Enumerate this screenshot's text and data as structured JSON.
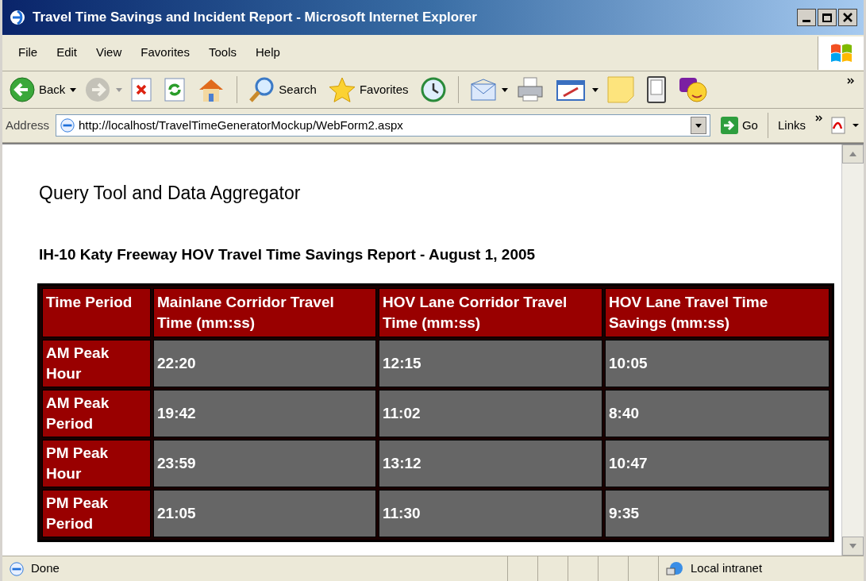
{
  "window": {
    "title": "Travel Time Savings and Incident Report - Microsoft Internet Explorer"
  },
  "menu": [
    "File",
    "Edit",
    "View",
    "Favorites",
    "Tools",
    "Help"
  ],
  "toolbar": [
    {
      "kind": "back",
      "label": "Back",
      "disabled": false
    },
    {
      "kind": "forward",
      "disabled": true
    },
    {
      "kind": "stop",
      "disabled": false
    },
    {
      "kind": "refresh",
      "disabled": false
    },
    {
      "kind": "home",
      "disabled": false
    },
    {
      "kind": "search",
      "label": "Search",
      "disabled": false
    },
    {
      "kind": "favorites",
      "label": "Favorites",
      "disabled": false
    },
    {
      "kind": "history",
      "disabled": false
    },
    {
      "kind": "mail",
      "disabled": false
    },
    {
      "kind": "print",
      "disabled": false
    },
    {
      "kind": "edit",
      "disabled": false
    },
    {
      "kind": "note",
      "disabled": false
    },
    {
      "kind": "device",
      "disabled": false
    },
    {
      "kind": "messenger",
      "disabled": false
    }
  ],
  "address_bar": {
    "label": "Address",
    "value": "http://localhost/TravelTimeGeneratorMockup/WebForm2.aspx",
    "go": "Go",
    "links": "Links"
  },
  "page": {
    "heading": "Query Tool and Data Aggregator",
    "report_title": "IH-10 Katy Freeway HOV Travel Time Savings Report - August 1, 2005",
    "table": {
      "columns": [
        "Time Period",
        "Mainlane Corridor Travel Time (mm:ss)",
        "HOV Lane Corridor Travel Time (mm:ss)",
        "HOV Lane Travel Time Savings (mm:ss)"
      ],
      "rows": [
        [
          "AM Peak Hour",
          "22:20",
          "12:15",
          "10:05"
        ],
        [
          "AM Peak Period",
          "19:42",
          "11:02",
          "8:40"
        ],
        [
          "PM Peak Hour",
          "23:59",
          "13:12",
          "10:47"
        ],
        [
          "PM Peak Period",
          "21:05",
          "11:30",
          "9:35"
        ]
      ]
    }
  },
  "status_bar": {
    "text": "Done",
    "zone": "Local intranet"
  }
}
